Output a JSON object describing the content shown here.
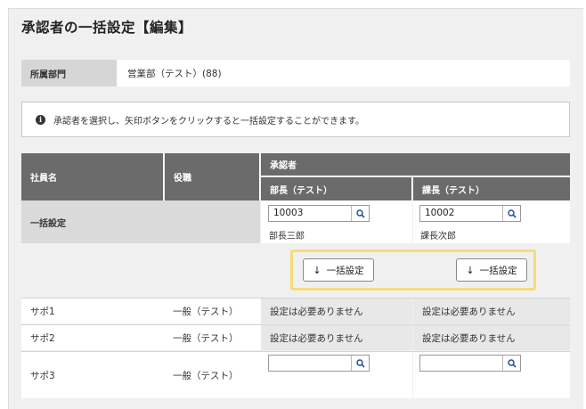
{
  "page": {
    "title": "承認者の一括設定【編集】"
  },
  "department": {
    "label": "所属部門",
    "value": "営業部（テスト）(88)"
  },
  "info": {
    "icon": "info-icon",
    "message": "承認者を選択し、矢印ボタンをクリックすると一括設定することができます。"
  },
  "table": {
    "headers": {
      "employee": "社員名",
      "role": "役職",
      "approver": "承認者",
      "approver_col1": "部長（テスト）",
      "approver_col2": "課長（テスト）"
    },
    "bulk_row": {
      "label": "一括設定",
      "col1_value": "10003",
      "col1_name": "部長三郎",
      "col2_value": "10002",
      "col2_name": "課長次郎"
    },
    "bulk_buttons": {
      "col1_label": "一括設定",
      "col2_label": "一括設定"
    },
    "rows": [
      {
        "name": "サポ1",
        "role": "一般（テスト）",
        "col1": "設定は必要ありません",
        "col2": "設定は必要ありません"
      },
      {
        "name": "サポ2",
        "role": "一般（テスト）",
        "col1": "設定は必要ありません",
        "col2": "設定は必要ありません"
      },
      {
        "name": "サポ3",
        "role": "一般（テスト）",
        "col1": "",
        "col2": ""
      }
    ]
  },
  "colors": {
    "header_bg": "#6b6b6b",
    "highlight_border": "#f5dc7a",
    "panel_bg": "#f0f0f0"
  }
}
